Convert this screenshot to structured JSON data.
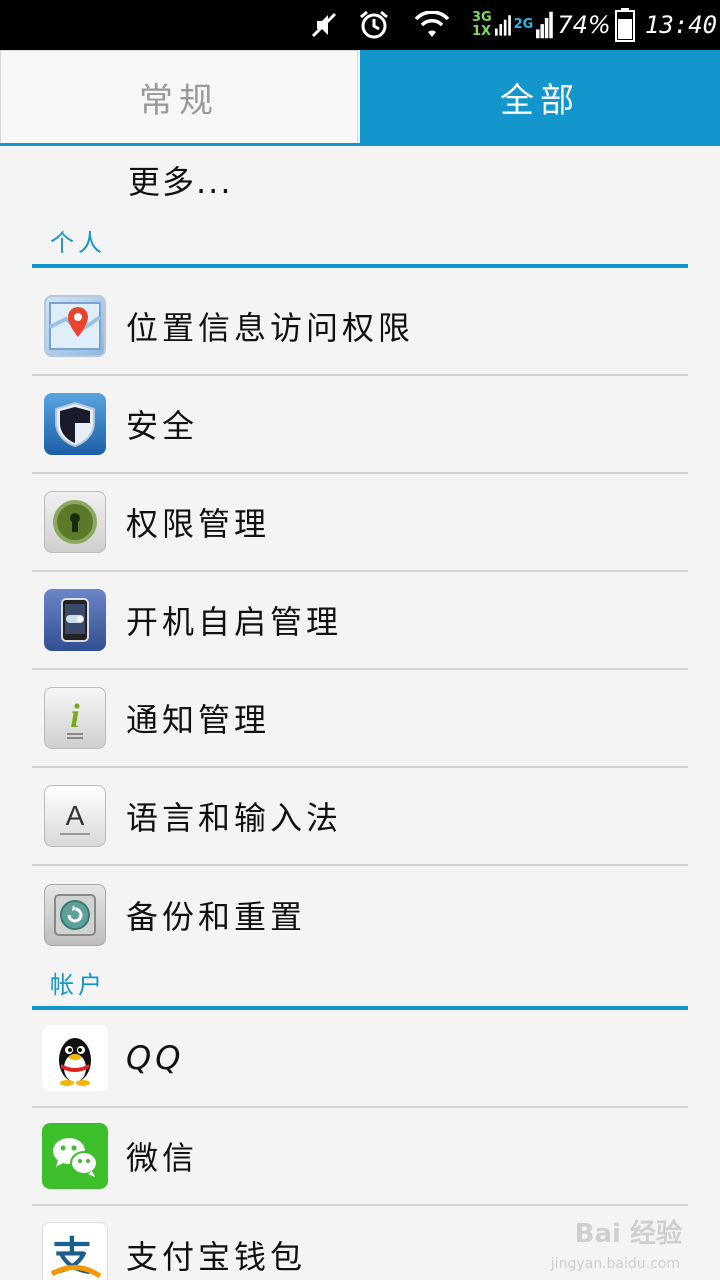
{
  "status_bar": {
    "network_3g": "3G",
    "network_1x": "1X",
    "network_2g": "2G",
    "battery_percent": "74%",
    "time": "13:40"
  },
  "tabs": [
    {
      "label": "常规",
      "active": false
    },
    {
      "label": "全部",
      "active": true
    }
  ],
  "more_label": "更多...",
  "sections": {
    "personal": {
      "title": "个人",
      "items": [
        {
          "label": "位置信息访问权限",
          "icon": "location-map-icon"
        },
        {
          "label": "安全",
          "icon": "security-shield-icon"
        },
        {
          "label": "权限管理",
          "icon": "keyhole-lock-icon"
        },
        {
          "label": "开机自启管理",
          "icon": "phone-toggle-icon"
        },
        {
          "label": "通知管理",
          "icon": "info-notification-icon"
        },
        {
          "label": "语言和输入法",
          "icon": "keyboard-key-a-icon"
        },
        {
          "label": "备份和重置",
          "icon": "backup-safe-icon"
        }
      ]
    },
    "accounts": {
      "title": "帐户",
      "items": [
        {
          "label": "QQ",
          "icon": "qq-penguin-icon"
        },
        {
          "label": "微信",
          "icon": "wechat-icon"
        },
        {
          "label": "支付宝钱包",
          "icon": "alipay-icon"
        }
      ]
    }
  },
  "watermark": {
    "text": "Bai 经验",
    "sub": "jingyan.baidu.com"
  },
  "colors": {
    "accent": "#1296cc",
    "background": "#f4f4f4",
    "divider": "#d2d2d2"
  }
}
